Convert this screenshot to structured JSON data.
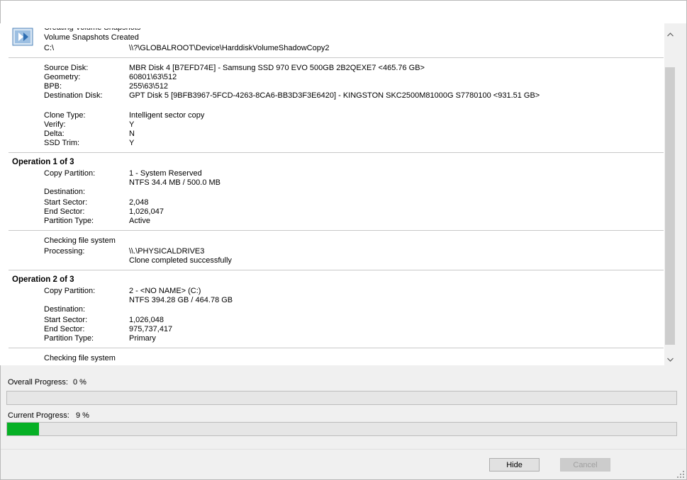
{
  "log": {
    "header_lines": {
      "partial": "Creating Volume Snapshots",
      "snapshots_created": "Volume Snapshots Created",
      "volume_label": "C:\\",
      "volume_path": "\\\\?\\GLOBALROOT\\Device\\HarddiskVolumeShadowCopy2"
    },
    "source": {
      "source_disk_label": "Source Disk:",
      "source_disk_value": "MBR Disk 4 [B7EFD74E] - Samsung SSD 970 EVO 500GB 2B2QEXE7  <465.76 GB>",
      "geometry_label": "Geometry:",
      "geometry_value": "60801\\63\\512",
      "bpb_label": "BPB:",
      "bpb_value": "255\\63\\512",
      "dest_disk_label": "Destination Disk:",
      "dest_disk_value": "GPT Disk 5 [9BFB3967-5FCD-4263-8CA6-BB3D3F3E6420] - KINGSTON SKC2500M81000G S7780100  <931.51 GB>"
    },
    "clone": {
      "clone_type_label": "Clone Type:",
      "clone_type_value": "Intelligent sector copy",
      "verify_label": "Verify:",
      "verify_value": "Y",
      "delta_label": "Delta:",
      "delta_value": "N",
      "ssd_trim_label": "SSD Trim:",
      "ssd_trim_value": "Y"
    },
    "op1": {
      "title": "Operation 1 of 3",
      "copy_label": "Copy Partition:",
      "copy_value": "1 - System Reserved",
      "copy_value2": "NTFS 34.4 MB / 500.0 MB",
      "dest_label": "Destination:",
      "start_label": "Start Sector:",
      "start_value": "2,048",
      "end_label": "End Sector:",
      "end_value": "1,026,047",
      "ptype_label": "Partition Type:",
      "ptype_value": "Active",
      "check_label": "Checking file system",
      "processing_label": "Processing:",
      "processing_value": "\\\\.\\PHYSICALDRIVE3",
      "result": "Clone completed successfully"
    },
    "op2": {
      "title": "Operation 2 of 3",
      "copy_label": "Copy Partition:",
      "copy_value": "2 - <NO NAME> (C:)",
      "copy_value2": "NTFS 394.28 GB / 464.78 GB",
      "dest_label": "Destination:",
      "start_label": "Start Sector:",
      "start_value": "1,026,048",
      "end_label": "End Sector:",
      "end_value": "975,737,417",
      "ptype_label": "Partition Type:",
      "ptype_value": "Primary",
      "check_label": "Checking file system"
    }
  },
  "progress": {
    "overall_label": "Overall Progress:",
    "overall_value": "0 %",
    "overall_fraction": 0,
    "current_label": "Current Progress:",
    "current_value": "9 %",
    "current_fraction": 0.048,
    "fill_color": "#06b025"
  },
  "buttons": {
    "hide_label": "Hide",
    "cancel_label": "Cancel"
  },
  "icons": {
    "app": "volume-snapshot-icon",
    "scroll_up": "chevron-up-icon",
    "scroll_down": "chevron-down-icon",
    "grip": "resize-grip-icon"
  }
}
